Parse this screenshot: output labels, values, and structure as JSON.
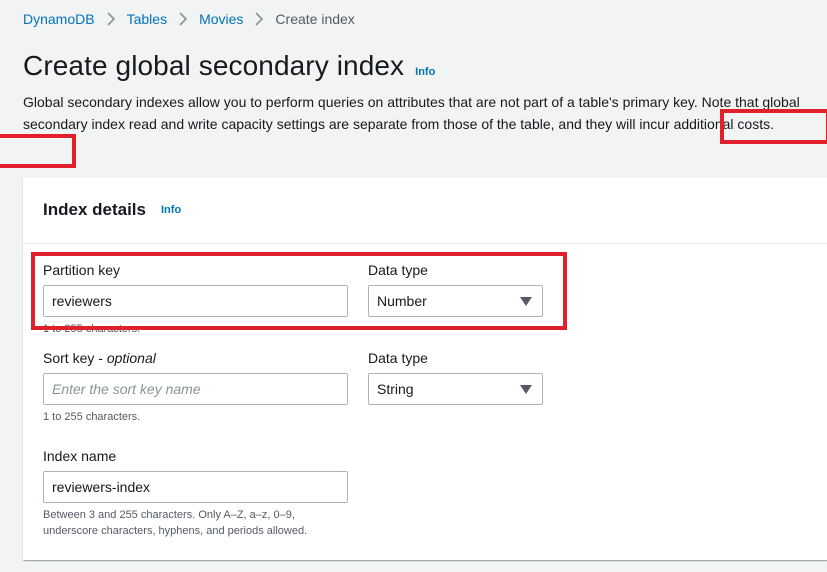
{
  "breadcrumb": {
    "items": [
      {
        "label": "DynamoDB"
      },
      {
        "label": "Tables"
      },
      {
        "label": "Movies"
      }
    ],
    "current": "Create index"
  },
  "header": {
    "title": "Create global secondary index",
    "info": "Info",
    "description": "Global secondary indexes allow you to perform queries on attributes that are not part of a table's primary key. Note that global secondary index read and write capacity settings are separate from those of the table, and they will incur additional costs."
  },
  "index_details": {
    "title": "Index details",
    "info": "Info",
    "partition_key": {
      "label": "Partition key",
      "value": "reviewers",
      "hint": "1 to 255 characters."
    },
    "partition_type": {
      "label": "Data type",
      "value": "Number"
    },
    "sort_key": {
      "label": "Sort key",
      "optional": "optional",
      "placeholder": "Enter the sort key name",
      "value": "",
      "hint": "1 to 255 characters."
    },
    "sort_type": {
      "label": "Data type",
      "value": "String"
    },
    "index_name": {
      "label": "Index name",
      "value": "reviewers-index",
      "hint_line1": "Between 3 and 255 characters. Only A–Z, a–z, 0–9,",
      "hint_line2": "underscore characters, hyphens, and periods allowed."
    }
  },
  "colors": {
    "link": "#0073bb",
    "annotation": "#e0202a",
    "background": "#f2f3f3"
  },
  "icons": {
    "breadcrumb_separator": "chevron-right-icon",
    "select_caret": "caret-down-icon"
  }
}
